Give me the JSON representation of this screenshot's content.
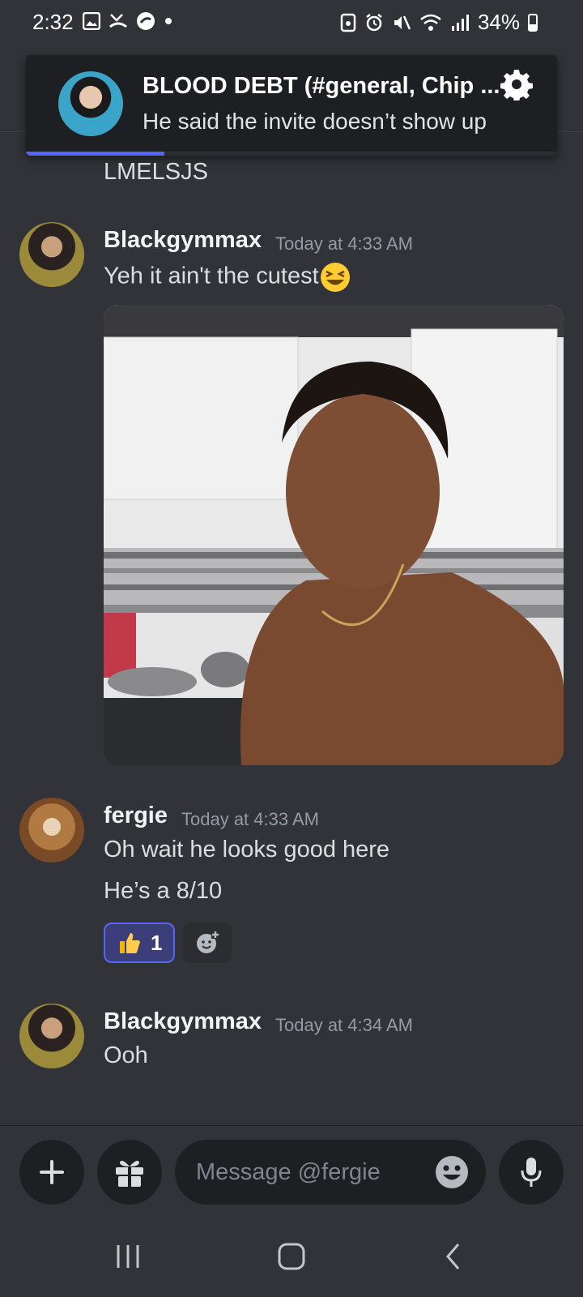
{
  "status_bar": {
    "time": "2:32",
    "battery": "34%",
    "icons_left": [
      "gallery-icon",
      "missed-call-icon",
      "app-icon",
      "dot-icon"
    ],
    "icons_right": [
      "nfc-lock-icon",
      "alarm-icon",
      "mute-icon",
      "wifi-icon",
      "signal-icon",
      "battery-icon"
    ]
  },
  "notification": {
    "title": "BLOOD DEBT (#general, Chip ...",
    "body": "He said the invite doesn’t show up",
    "progress": 0.26
  },
  "messages": [
    {
      "continuation_text": "LMELSJS"
    },
    {
      "author": "Blackgymmax",
      "time": "Today at 4:33 AM",
      "text": "Yeh it ain't the cutest",
      "emoji": "laughing-squint-emoji",
      "attachment": "selfie-photo"
    },
    {
      "author": "fergie",
      "time": "Today at 4:33 AM",
      "lines": [
        "Oh wait he looks good here",
        "He’s a 8/10"
      ],
      "reactions": [
        {
          "emoji": "thumbs-up-icon",
          "count": "1",
          "active": true
        }
      ]
    },
    {
      "author": "Blackgymmax",
      "time": "Today at 4:34 AM",
      "text": "Ooh"
    }
  ],
  "composer": {
    "placeholder": "Message @fergie"
  },
  "colors": {
    "background": "#313338",
    "input_bg": "#1e1f22",
    "accent": "#5865f2"
  }
}
